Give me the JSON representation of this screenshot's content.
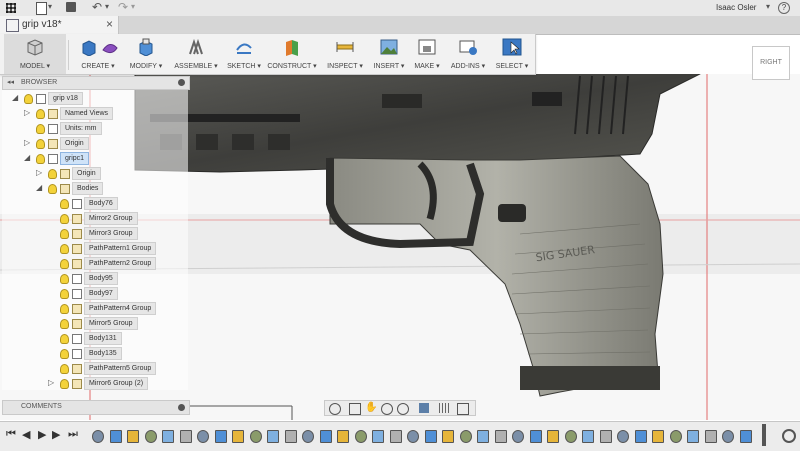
{
  "app": {
    "tab_title": "grip v18*",
    "user_name": "Isaac Osler",
    "user_chevron": "▾",
    "help_icon": "?"
  },
  "toolbar": {
    "model": "MODEL",
    "create": "CREATE",
    "modify": "MODIFY",
    "assemble": "ASSEMBLE",
    "sketch": "SKETCH",
    "construct": "CONSTRUCT",
    "inspect": "INSPECT",
    "insert": "INSERT",
    "make": "MAKE",
    "addins": "ADD-INS",
    "select": "SELECT",
    "dropdown": "▾"
  },
  "browser": {
    "title": "BROWSER",
    "rows": [
      {
        "label": "grip v18",
        "indent": 1,
        "arrow": "◢",
        "kind": "doc"
      },
      {
        "label": "Named Views",
        "indent": 2,
        "arrow": "▷",
        "kind": "folder"
      },
      {
        "label": "Units: mm",
        "indent": 2,
        "arrow": "",
        "kind": "doc"
      },
      {
        "label": "Origin",
        "indent": 2,
        "arrow": "▷",
        "kind": "folder"
      },
      {
        "label": "gripc1",
        "indent": 2,
        "arrow": "◢",
        "kind": "comp",
        "selected": true
      },
      {
        "label": "Origin",
        "indent": 3,
        "arrow": "▷",
        "kind": "folder"
      },
      {
        "label": "Bodies",
        "indent": 3,
        "arrow": "◢",
        "kind": "folder"
      },
      {
        "label": "Body76",
        "indent": 4,
        "arrow": "",
        "kind": "body"
      },
      {
        "label": "Mirror2 Group",
        "indent": 4,
        "arrow": "",
        "kind": "folder"
      },
      {
        "label": "Mirror3 Group",
        "indent": 4,
        "arrow": "",
        "kind": "folder"
      },
      {
        "label": "PathPattern1 Group",
        "indent": 4,
        "arrow": "",
        "kind": "folder"
      },
      {
        "label": "PathPattern2 Group",
        "indent": 4,
        "arrow": "",
        "kind": "folder"
      },
      {
        "label": "Body95",
        "indent": 4,
        "arrow": "",
        "kind": "body"
      },
      {
        "label": "Body97",
        "indent": 4,
        "arrow": "",
        "kind": "body"
      },
      {
        "label": "PathPattern4 Group",
        "indent": 4,
        "arrow": "",
        "kind": "folder"
      },
      {
        "label": "Mirror5 Group",
        "indent": 4,
        "arrow": "",
        "kind": "folder"
      },
      {
        "label": "Body131",
        "indent": 4,
        "arrow": "",
        "kind": "body"
      },
      {
        "label": "Body135",
        "indent": 4,
        "arrow": "",
        "kind": "body"
      },
      {
        "label": "PathPattern5 Group",
        "indent": 4,
        "arrow": "",
        "kind": "folder"
      },
      {
        "label": "Mirror6 Group (2)",
        "indent": 4,
        "arrow": "▷",
        "kind": "folder"
      }
    ]
  },
  "comments": {
    "title": "COMMENTS"
  },
  "viewcube": {
    "face": "RIGHT"
  },
  "model_text": {
    "brand": "SIG SAUER"
  },
  "colors": {
    "accent_blue": "#3a78c3",
    "toolbar_bg": "#f2f2f2",
    "gun_dark": "#4a4a47"
  }
}
